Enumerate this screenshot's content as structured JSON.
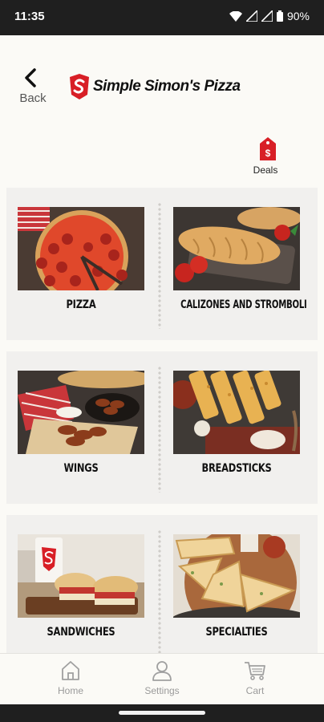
{
  "status_bar": {
    "time": "11:35",
    "battery": "90%"
  },
  "header": {
    "back_label": "Back",
    "logo_text": "Simple Simon's Pizza"
  },
  "deals": {
    "label": "Deals"
  },
  "menu": {
    "items": [
      {
        "label": "PIZZA"
      },
      {
        "label": "CALIZONES AND STROMBOLI"
      },
      {
        "label": "WINGS"
      },
      {
        "label": "BREADSTICKS"
      },
      {
        "label": "SANDWICHES"
      },
      {
        "label": "SPECIALTIES"
      }
    ]
  },
  "nav": {
    "home": "Home",
    "settings": "Settings",
    "cart": "Cart"
  },
  "colors": {
    "brand_red": "#d81f26",
    "nav_gray": "#9a9a9a"
  }
}
